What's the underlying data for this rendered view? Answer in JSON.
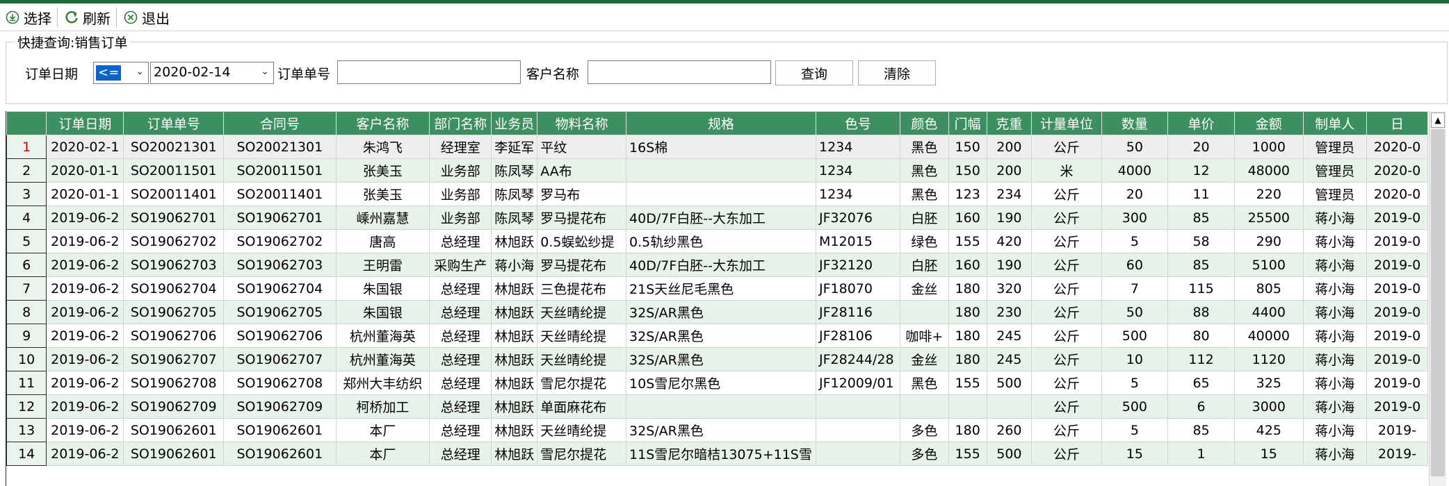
{
  "toolbar": {
    "select_label": "选择",
    "refresh_label": "刷新",
    "exit_label": "退出"
  },
  "query": {
    "legend": "快捷查询:销售订单",
    "date_label": "订单日期",
    "operator_value": "<=",
    "date_value": "2020-02-14",
    "order_no_label": "订单单号",
    "order_no_value": "",
    "customer_label": "客户名称",
    "customer_value": "",
    "search_label": "查询",
    "clear_label": "清除"
  },
  "grid": {
    "columns": [
      "订单日期",
      "订单单号",
      "合同号",
      "客户名称",
      "部门名称",
      "业务员",
      "物料名称",
      "规格",
      "色号",
      "颜色",
      "门幅",
      "克重",
      "计量单位",
      "数量",
      "单价",
      "金额",
      "制单人",
      "日"
    ],
    "rows": [
      [
        "1",
        "2020-02-1",
        "SO20021301",
        "SO20021301",
        "朱鸿飞",
        "经理室",
        "李延军",
        "平纹",
        "16S棉",
        "1234",
        "黑色",
        "150",
        "200",
        "公斤",
        "50",
        "20",
        "1000",
        "管理员",
        "2020-0"
      ],
      [
        "2",
        "2020-01-1",
        "SO20011501",
        "SO20011501",
        "张美玉",
        "业务部",
        "陈凤琴",
        "AA布",
        "",
        "1234",
        "黑色",
        "150",
        "200",
        "米",
        "4000",
        "12",
        "48000",
        "管理员",
        "2020-0"
      ],
      [
        "3",
        "2020-01-1",
        "SO20011401",
        "SO20011401",
        "张美玉",
        "业务部",
        "陈凤琴",
        "罗马布",
        "",
        "1234",
        "黑色",
        "123",
        "234",
        "公斤",
        "20",
        "11",
        "220",
        "管理员",
        "2020-0"
      ],
      [
        "4",
        "2019-06-2",
        "SO19062701",
        "SO19062701",
        "嵊州嘉慧",
        "业务部",
        "陈凤琴",
        "罗马提花布",
        "40D/7F白胚--大东加工",
        "JF32076",
        "白胚",
        "160",
        "190",
        "公斤",
        "300",
        "85",
        "25500",
        "蒋小海",
        "2019-0"
      ],
      [
        "5",
        "2019-06-2",
        "SO19062702",
        "SO19062702",
        "唐高",
        "总经理",
        "林旭跃",
        "0.5蜈蚣纱提",
        "0.5轨纱黑色",
        "M12015",
        "绿色",
        "155",
        "420",
        "公斤",
        "5",
        "58",
        "290",
        "蒋小海",
        "2019-0"
      ],
      [
        "6",
        "2019-06-2",
        "SO19062703",
        "SO19062703",
        "王明雷",
        "采购生产",
        "蒋小海",
        "罗马提花布",
        "40D/7F白胚--大东加工",
        "JF32120",
        "白胚",
        "160",
        "190",
        "公斤",
        "60",
        "85",
        "5100",
        "蒋小海",
        "2019-0"
      ],
      [
        "7",
        "2019-06-2",
        "SO19062704",
        "SO19062704",
        "朱国银",
        "总经理",
        "林旭跃",
        "三色提花布",
        "21S天丝尼毛黑色",
        "JF18070",
        "金丝",
        "180",
        "320",
        "公斤",
        "7",
        "115",
        "805",
        "蒋小海",
        "2019-0"
      ],
      [
        "8",
        "2019-06-2",
        "SO19062705",
        "SO19062705",
        "朱国银",
        "总经理",
        "林旭跃",
        "天丝晴纶提",
        "32S/AR黑色",
        "JF28116",
        "",
        "180",
        "230",
        "公斤",
        "50",
        "88",
        "4400",
        "蒋小海",
        "2019-0"
      ],
      [
        "9",
        "2019-06-2",
        "SO19062706",
        "SO19062706",
        "杭州董海英",
        "总经理",
        "林旭跃",
        "天丝晴纶提",
        "32S/AR黑色",
        "JF28106",
        "咖啡+",
        "180",
        "245",
        "公斤",
        "500",
        "80",
        "40000",
        "蒋小海",
        "2019-0"
      ],
      [
        "10",
        "2019-06-2",
        "SO19062707",
        "SO19062707",
        "杭州董海英",
        "总经理",
        "林旭跃",
        "天丝晴纶提",
        "32S/AR黑色",
        "JF28244/28",
        "金丝",
        "180",
        "245",
        "公斤",
        "10",
        "112",
        "1120",
        "蒋小海",
        "2019-0"
      ],
      [
        "11",
        "2019-06-2",
        "SO19062708",
        "SO19062708",
        "郑州大丰纺织",
        "总经理",
        "林旭跃",
        "雪尼尔提花",
        "10S雪尼尔黑色",
        "JF12009/01",
        "黑色",
        "155",
        "500",
        "公斤",
        "5",
        "65",
        "325",
        "蒋小海",
        "2019-0"
      ],
      [
        "12",
        "2019-06-2",
        "SO19062709",
        "SO19062709",
        "柯桥加工",
        "总经理",
        "林旭跃",
        "单面麻花布",
        "",
        "",
        "",
        "",
        "",
        "公斤",
        "500",
        "6",
        "3000",
        "蒋小海",
        "2019-0"
      ],
      [
        "13",
        "2019-06-2",
        "SO19062601",
        "SO19062601",
        "本厂",
        "总经理",
        "林旭跃",
        "天丝晴纶提",
        "32S/AR黑色",
        "",
        "多色",
        "180",
        "260",
        "公斤",
        "5",
        "85",
        "425",
        "蒋小海",
        "2019-"
      ],
      [
        "14",
        "2019-06-2",
        "SO19062601",
        "SO19062601",
        "本厂",
        "总经理",
        "林旭跃",
        "雪尼尔提花",
        "11S雪尼尔暗桔13075+11S雪",
        "",
        "多色",
        "155",
        "500",
        "公斤",
        "15",
        "1",
        "15",
        "蒋小海",
        "2019-"
      ]
    ]
  }
}
